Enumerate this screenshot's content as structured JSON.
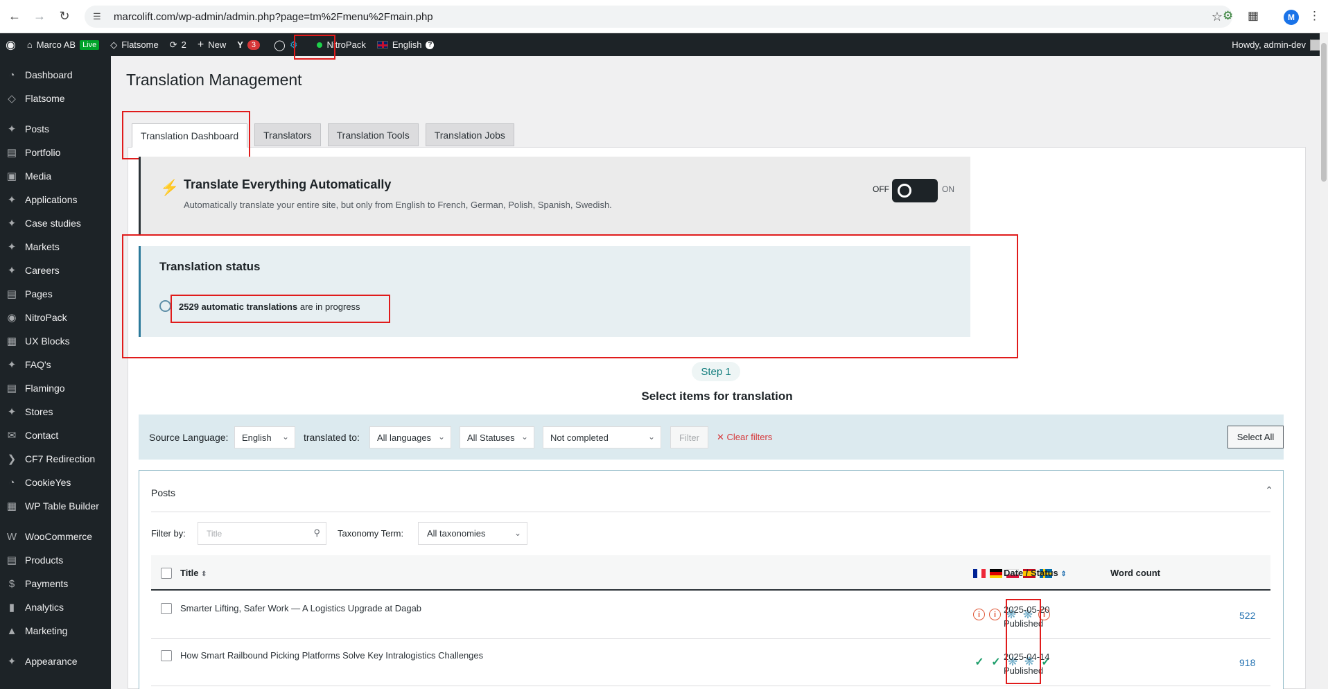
{
  "browser": {
    "url": "marcolift.com/wp-admin/admin.php?page=tm%2Fmenu%2Fmain.php",
    "profile_initial": "M"
  },
  "adminbar": {
    "site_name": "Marco AB",
    "live_badge": "Live",
    "theme": "Flatsome",
    "updates_count": "2",
    "new_label": "New",
    "yoast_count": "3",
    "nitropack": "NitroPack",
    "language": "English",
    "language_help": "?",
    "howdy": "Howdy, admin-dev"
  },
  "sidebar": {
    "items": [
      {
        "label": "Dashboard",
        "icon": "dashboard-icon"
      },
      {
        "label": "Flatsome",
        "icon": "flatsome-icon"
      },
      {
        "label": "Posts",
        "icon": "pin-icon"
      },
      {
        "label": "Portfolio",
        "icon": "folder-icon"
      },
      {
        "label": "Media",
        "icon": "media-icon"
      },
      {
        "label": "Applications",
        "icon": "pin-icon"
      },
      {
        "label": "Case studies",
        "icon": "pin-icon"
      },
      {
        "label": "Markets",
        "icon": "pin-icon"
      },
      {
        "label": "Careers",
        "icon": "pin-icon"
      },
      {
        "label": "Pages",
        "icon": "pages-icon"
      },
      {
        "label": "NitroPack",
        "icon": "nitropack-icon"
      },
      {
        "label": "UX Blocks",
        "icon": "blocks-icon"
      },
      {
        "label": "FAQ's",
        "icon": "pin-icon"
      },
      {
        "label": "Flamingo",
        "icon": "flamingo-icon"
      },
      {
        "label": "Stores",
        "icon": "pin-icon"
      },
      {
        "label": "Contact",
        "icon": "mail-icon"
      },
      {
        "label": "CF7 Redirection",
        "icon": "redirect-icon"
      },
      {
        "label": "CookieYes",
        "icon": "cookie-icon"
      },
      {
        "label": "WP Table Builder",
        "icon": "table-icon"
      },
      {
        "label": "WooCommerce",
        "icon": "woo-icon"
      },
      {
        "label": "Products",
        "icon": "products-icon"
      },
      {
        "label": "Payments",
        "icon": "payments-icon"
      },
      {
        "label": "Analytics",
        "icon": "analytics-icon"
      },
      {
        "label": "Marketing",
        "icon": "marketing-icon"
      },
      {
        "label": "Appearance",
        "icon": "appearance-icon"
      }
    ]
  },
  "page": {
    "title": "Translation Management",
    "tabs": [
      "Translation Dashboard",
      "Translators",
      "Translation Tools",
      "Translation Jobs"
    ]
  },
  "auto_translate": {
    "title": "Translate Everything Automatically",
    "description": "Automatically translate your entire site, but only from English to French, German, Polish, Spanish, Swedish.",
    "off_label": "OFF",
    "on_label": "ON"
  },
  "status": {
    "title": "Translation status",
    "count_text": "2529 automatic translations",
    "suffix": " are in progress"
  },
  "step": {
    "badge": "Step 1",
    "heading": "Select items for translation"
  },
  "filters": {
    "source_label": "Source Language:",
    "source_value": "English",
    "translated_label": "translated to:",
    "translated_value": "All languages",
    "statuses_value": "All Statuses",
    "completion_value": "Not completed",
    "filter_button": "Filter",
    "clear_filters": "Clear filters",
    "select_all": "Select All"
  },
  "posts": {
    "section_title": "Posts",
    "filter_by_label": "Filter by:",
    "title_placeholder": "Title",
    "taxonomy_label": "Taxonomy Term:",
    "taxonomy_value": "All taxonomies",
    "columns": {
      "title": "Title",
      "date_status": "Date / Status",
      "word_count": "Word count"
    },
    "languages": [
      "French",
      "German",
      "Polish",
      "Spanish",
      "Swedish"
    ],
    "rows": [
      {
        "title": "Smarter Lifting, Safer Work — A Logistics Upgrade at Dagab",
        "date": "2025-05-20",
        "status": "Published",
        "word_count": "522",
        "language_states": [
          "needs-update",
          "needs-update",
          "in-progress",
          "in-progress",
          "needs-update"
        ]
      },
      {
        "title": "How Smart Railbound Picking Platforms Solve Key Intralogistics Challenges",
        "date": "2025-04-14",
        "status": "Published",
        "word_count": "918",
        "language_states": [
          "complete",
          "complete",
          "in-progress",
          "in-progress",
          "complete"
        ]
      }
    ]
  },
  "colors": {
    "admin_bar": "#1d2327",
    "highlight_box": "#e01b1b",
    "status_border": "#2c7a9b",
    "clear_filters": "#d63638",
    "word_count_link": "#2271b1"
  }
}
